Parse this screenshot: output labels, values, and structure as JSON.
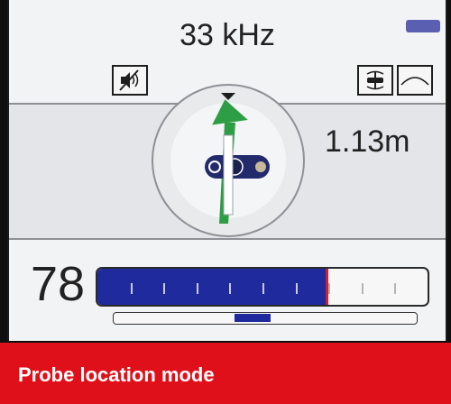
{
  "status": {
    "frequency": "33 kHz",
    "battery_icon": "battery-icon",
    "battery_color": "#5a5fb2"
  },
  "toolbar": {
    "left_icon": "speaker-muted-icon",
    "right_icons": [
      "probe-signal-icon",
      "peak-arc-icon"
    ]
  },
  "readout": {
    "depth": "1.13m"
  },
  "locator": {
    "arrow_color": "#2e9e45",
    "probe_body_color": "#222a6c"
  },
  "signal": {
    "strength": "78",
    "strength_fraction": 0.7,
    "bar_color": "#1f2a9c",
    "peak_marker_color": "#d0202a",
    "gain_position_fraction": 0.4
  },
  "banner": {
    "text": "Probe location mode",
    "color": "#e0101a"
  }
}
